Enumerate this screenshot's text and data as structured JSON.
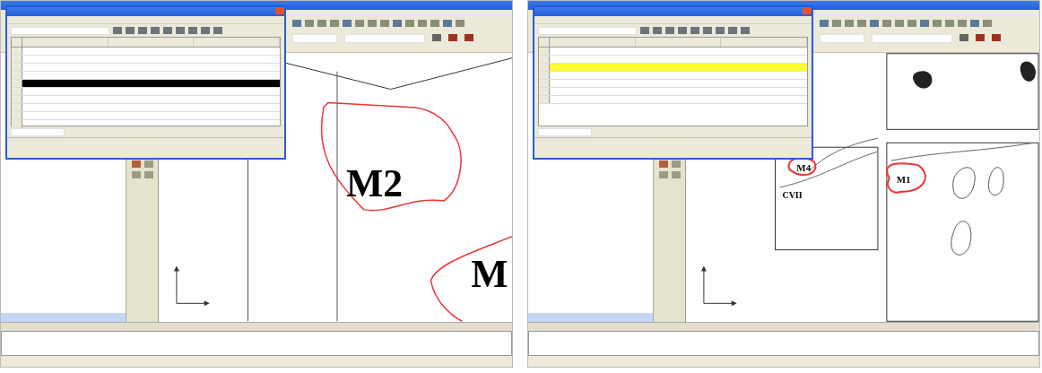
{
  "screens": [
    {
      "color": "#000000",
      "rows": [
        {
          "selected": false
        },
        {
          "selected": false
        },
        {
          "selected": false
        },
        {
          "selected": false
        },
        {
          "selected": true
        },
        {
          "selected": false
        },
        {
          "selected": false
        },
        {
          "selected": false
        },
        {
          "selected": false
        },
        {
          "selected": false
        }
      ],
      "map_labels": [
        "M2",
        "M"
      ]
    },
    {
      "color": "#ffff33",
      "rows": [
        {
          "selected": false
        },
        {
          "selected": false
        },
        {
          "selected": true
        },
        {
          "selected": false
        },
        {
          "selected": false
        },
        {
          "selected": false
        },
        {
          "selected": false
        }
      ],
      "map_labels": [
        "M4",
        "CVII",
        "M1"
      ]
    }
  ]
}
